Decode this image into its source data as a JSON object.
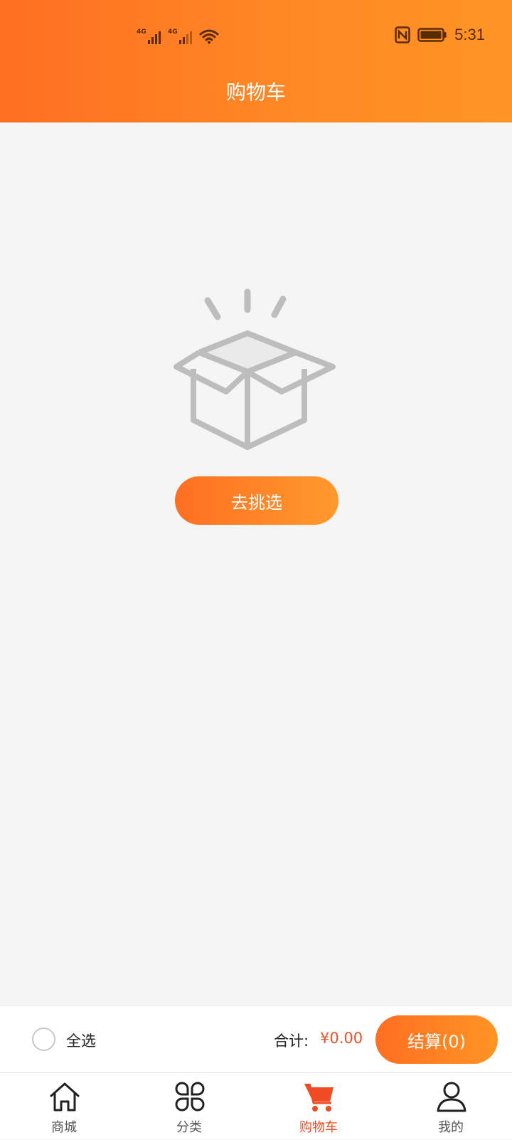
{
  "status_bar": {
    "network1": "4G",
    "network2": "4G",
    "time": "5:31"
  },
  "header": {
    "title": "购物车"
  },
  "empty_state": {
    "button_label": "去挑选"
  },
  "checkout": {
    "select_all_label": "全选",
    "total_label": "合计:",
    "total_amount": "¥0.00",
    "checkout_label": "结算(0)"
  },
  "tabs": [
    {
      "label": "商城",
      "icon": "home-icon",
      "active": false
    },
    {
      "label": "分类",
      "icon": "category-icon",
      "active": false
    },
    {
      "label": "购物车",
      "icon": "cart-icon",
      "active": true
    },
    {
      "label": "我的",
      "icon": "profile-icon",
      "active": false
    }
  ],
  "colors": {
    "accent": "#ff7a22",
    "price": "#e8522a",
    "active_tab": "#f04b22"
  }
}
